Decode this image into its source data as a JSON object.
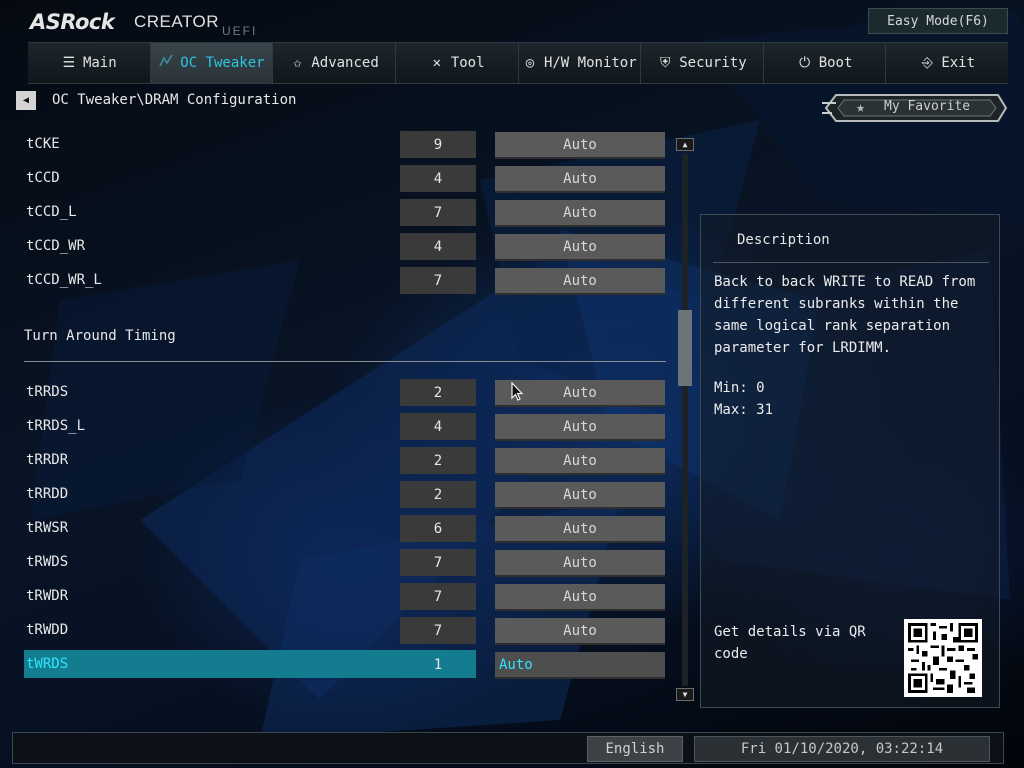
{
  "header": {
    "brand": "ASRock",
    "product": "CREATOR",
    "firmware": "UEFI",
    "easy_mode_label": "Easy Mode(F6)"
  },
  "tabs": [
    {
      "label": "Main",
      "icon": "list-icon",
      "active": false
    },
    {
      "label": "OC Tweaker",
      "icon": "oc-tweaker-icon",
      "active": true
    },
    {
      "label": "Advanced",
      "icon": "star-icon",
      "active": false
    },
    {
      "label": "Tool",
      "icon": "tools-icon",
      "active": false
    },
    {
      "label": "H/W Monitor",
      "icon": "monitor-icon",
      "active": false
    },
    {
      "label": "Security",
      "icon": "shield-icon",
      "active": false
    },
    {
      "label": "Boot",
      "icon": "power-icon",
      "active": false
    },
    {
      "label": "Exit",
      "icon": "exit-icon",
      "active": false
    }
  ],
  "breadcrumb": "OC Tweaker\\DRAM Configuration",
  "favorite_label": "My Favorite",
  "settings_group_1": [
    {
      "name": "tCKE",
      "value": "9",
      "option": "Auto"
    },
    {
      "name": "tCCD",
      "value": "4",
      "option": "Auto"
    },
    {
      "name": "tCCD_L",
      "value": "7",
      "option": "Auto"
    },
    {
      "name": "tCCD_WR",
      "value": "4",
      "option": "Auto"
    },
    {
      "name": "tCCD_WR_L",
      "value": "7",
      "option": "Auto"
    }
  ],
  "section_title": "Turn Around Timing",
  "settings_group_2": [
    {
      "name": "tRRDS",
      "value": "2",
      "option": "Auto"
    },
    {
      "name": "tRRDS_L",
      "value": "4",
      "option": "Auto"
    },
    {
      "name": "tRRDR",
      "value": "2",
      "option": "Auto"
    },
    {
      "name": "tRRDD",
      "value": "2",
      "option": "Auto"
    },
    {
      "name": "tRWSR",
      "value": "6",
      "option": "Auto"
    },
    {
      "name": "tRWDS",
      "value": "7",
      "option": "Auto"
    },
    {
      "name": "tRWDR",
      "value": "7",
      "option": "Auto"
    },
    {
      "name": "tRWDD",
      "value": "7",
      "option": "Auto"
    },
    {
      "name": "tWRDS",
      "value": "1",
      "option": "Auto",
      "selected": true
    }
  ],
  "description": {
    "title": "Description",
    "text": "Back to back WRITE to READ from\ndifferent subranks within the\nsame logical rank separation\nparameter for LRDIMM.",
    "min": "Min: 0",
    "max": "Max: 31",
    "qr_text": "Get details via QR code"
  },
  "footer": {
    "language": "English",
    "datetime": "Fri 01/10/2020, 03:22:14"
  },
  "colors": {
    "accent": "#29c6e0",
    "selected_row": "#137c8f",
    "selected_text": "#2ee6ff"
  }
}
